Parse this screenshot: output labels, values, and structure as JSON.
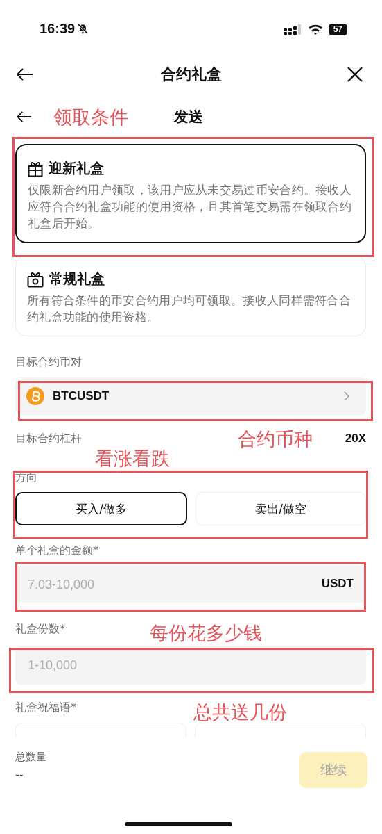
{
  "status_bar": {
    "time": "16:39",
    "silent": true,
    "battery": "57"
  },
  "nav": {
    "title": "合约礼盒"
  },
  "step": {
    "title": "发送"
  },
  "gift_types": [
    {
      "kind": "new",
      "title": "迎新礼盒",
      "description": "仅限新合约用户领取，该用户应从未交易过币安合约。接收人应符合合约礼盒功能的使用资格，且其首笔交易需在领取合约礼盒后开始。",
      "selected": true
    },
    {
      "kind": "regular",
      "title": "常规礼盒",
      "description": "所有符合条件的币安合约用户均可领取。接收人同样需符合合约礼盒功能的使用资格。",
      "selected": false
    }
  ],
  "pair": {
    "label": "目标合约币对",
    "value": "BTCUSDT"
  },
  "leverage": {
    "label": "目标合约杠杆",
    "value": "20X"
  },
  "direction": {
    "label": "方向",
    "options": [
      {
        "label": "买入/做多",
        "selected": true
      },
      {
        "label": "卖出/做空",
        "selected": false
      }
    ]
  },
  "amount": {
    "label": "单个礼盒的金额*",
    "placeholder": "7.03-10,000",
    "unit": "USDT"
  },
  "count": {
    "label": "礼盒份数*",
    "placeholder": "1-10,000"
  },
  "greeting": {
    "label": "礼盒祝福语*",
    "options": [
      {
        "selected": false
      },
      {
        "selected": false
      }
    ]
  },
  "footer": {
    "total_label": "总数量",
    "total_value": "--",
    "continue_button": {
      "label": "继续",
      "disabled": true
    }
  },
  "annotations": {
    "labels": [
      "领取条件",
      "合约币种",
      "看涨看跌",
      "每份花多少钱",
      "总共送几份"
    ]
  }
}
